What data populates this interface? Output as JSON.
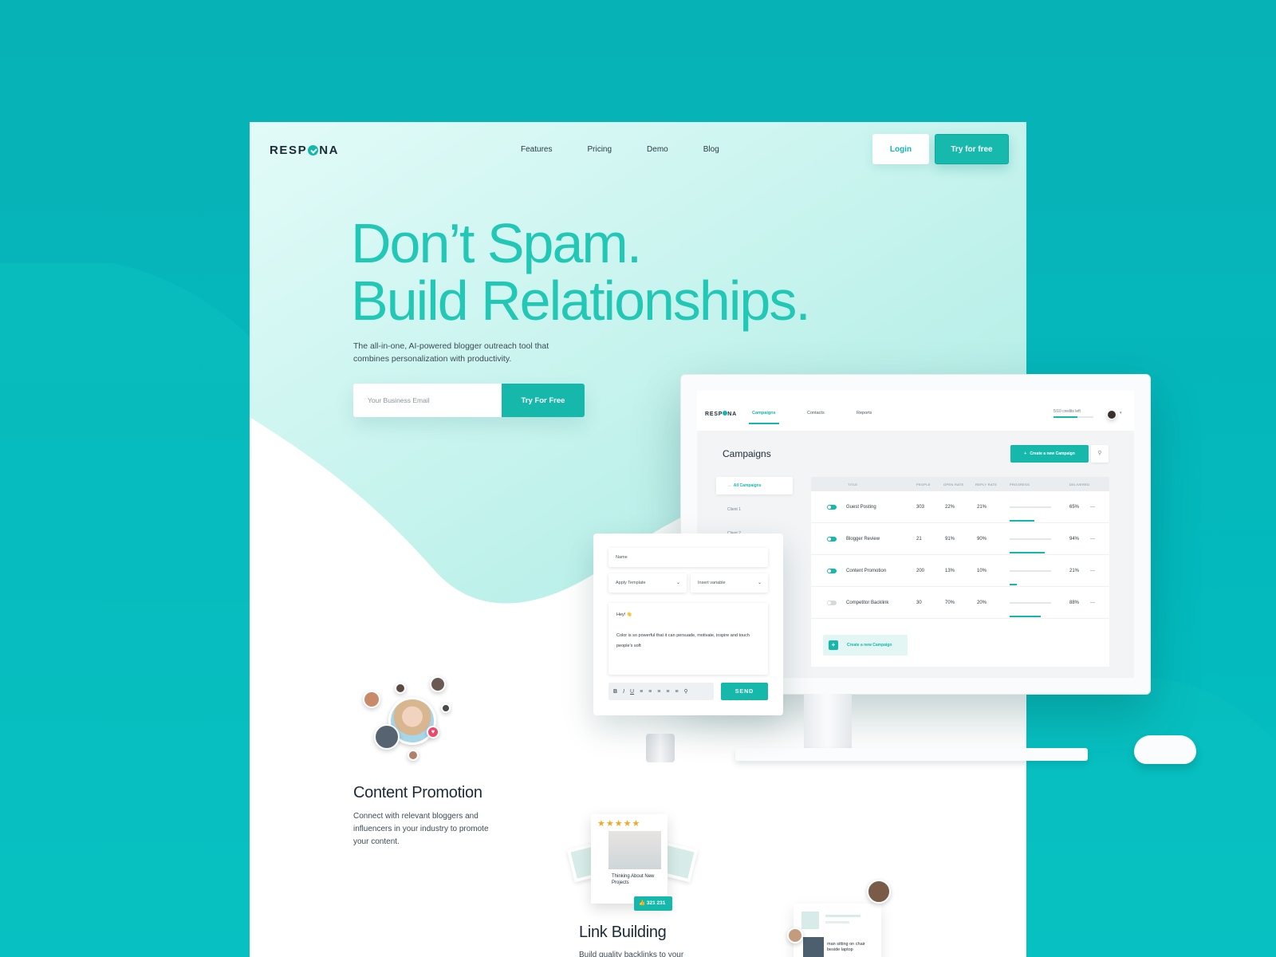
{
  "nav": {
    "logo": "RESPONA",
    "logo_left": "RESP",
    "logo_right": "NA",
    "links": [
      "Features",
      "Pricing",
      "Demo",
      "Blog"
    ],
    "login_label": "Login",
    "try_label": "Try for free"
  },
  "hero": {
    "headline_line1": "Don’t Spam.",
    "headline_line2": "Build Relationships.",
    "subtext": "The all-in-one, AI-powered blogger outreach tool that combines personalization with productivity.",
    "email_placeholder": "Your Business Email",
    "cta_label": "Try For Free"
  },
  "features": [
    {
      "title": "Content Promotion",
      "description": "Connect with relevant bloggers and influencers in your industry to promote your content."
    },
    {
      "title": "Link Building",
      "description": "Build quality backlinks to your"
    }
  ],
  "link_card": {
    "rating": "★★★★★",
    "caption": "Thinking About New Projects",
    "likes": "321 231"
  },
  "mini_card": {
    "caption": "man sitting on chair beside laptop"
  },
  "app": {
    "logo_left": "RESP",
    "logo_right": "NA",
    "tabs": [
      "Campaigns",
      "Contacts",
      "Reports"
    ],
    "credits": "5/10 credits left",
    "credits_fraction": 0.6,
    "page_title": "Campaigns",
    "create_label": "Create a new Campaign",
    "sidebar": [
      "All Campaigns",
      "Client 1",
      "Client 2"
    ],
    "columns": [
      "TITLE",
      "PEOPLE",
      "OPEN RATE",
      "REPLY RATE",
      "PROGRESS",
      "DELIVERED"
    ],
    "rows": [
      {
        "on": true,
        "title": "Guest Posting",
        "people": "303",
        "open": "22%",
        "reply": "21%",
        "progress": 0.6,
        "delivered": "65%"
      },
      {
        "on": true,
        "title": "Blogger Review",
        "people": "21",
        "open": "91%",
        "reply": "90%",
        "progress": 0.85,
        "delivered": "94%"
      },
      {
        "on": true,
        "title": "Content Promotion",
        "people": "200",
        "open": "13%",
        "reply": "10%",
        "progress": 0.18,
        "delivered": "21%"
      },
      {
        "on": false,
        "title": "Competitor Backlink",
        "people": "30",
        "open": "70%",
        "reply": "20%",
        "progress": 0.75,
        "delivered": "88%"
      }
    ],
    "create_small_label": "Create a new Campaign"
  },
  "composer": {
    "name_placeholder": "Name",
    "apply_template": "Apply Template",
    "insert_variable": "Insert variable",
    "greeting": "Hey! 👋",
    "body": "Color is so powerful that it can persuade, motivate, inspire and touch people’s soft",
    "toolbar": [
      "B",
      "I",
      "U",
      "≡",
      "≡",
      "≡",
      "≡",
      "≡",
      "⚲"
    ],
    "send_label": "SEND"
  },
  "colors": {
    "accent": "#15b8ab",
    "background": "#03b7bb",
    "headline": "#22c7b5"
  }
}
